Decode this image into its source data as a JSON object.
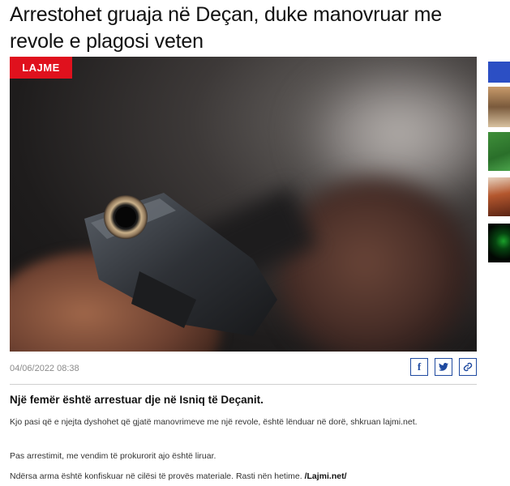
{
  "article": {
    "title": "Arrestohet gruaja në Deçan, duke manovruar me revole e plagosi veten",
    "category": "LAJME",
    "date": "04/06/2022 08:38",
    "lead": "Një femër është arrestuar dje në Isniq të Deçanit.",
    "paragraphs": [
      "Kjo pasi që e njejta dyshohet që gjatë manovrimeve me një revole, është lënduar në dorë, shkruan lajmi.net.",
      "Pas arrestimit, me vendim të prokurorit ajo është liruar.",
      "Ndërsa arma është konfiskuar në cilësi të provës materiale. Rasti nën hetime."
    ],
    "source_tag": "/Lajmi.net/"
  },
  "share": [
    {
      "icon": "facebook-icon",
      "glyph": "f"
    },
    {
      "icon": "twitter-icon",
      "glyph": "t"
    },
    {
      "icon": "link-icon",
      "glyph": "🔗"
    }
  ],
  "colors": {
    "accent": "#e0111d",
    "share_border": "#1f4aa0",
    "rail_top": "#2c4fc4"
  }
}
